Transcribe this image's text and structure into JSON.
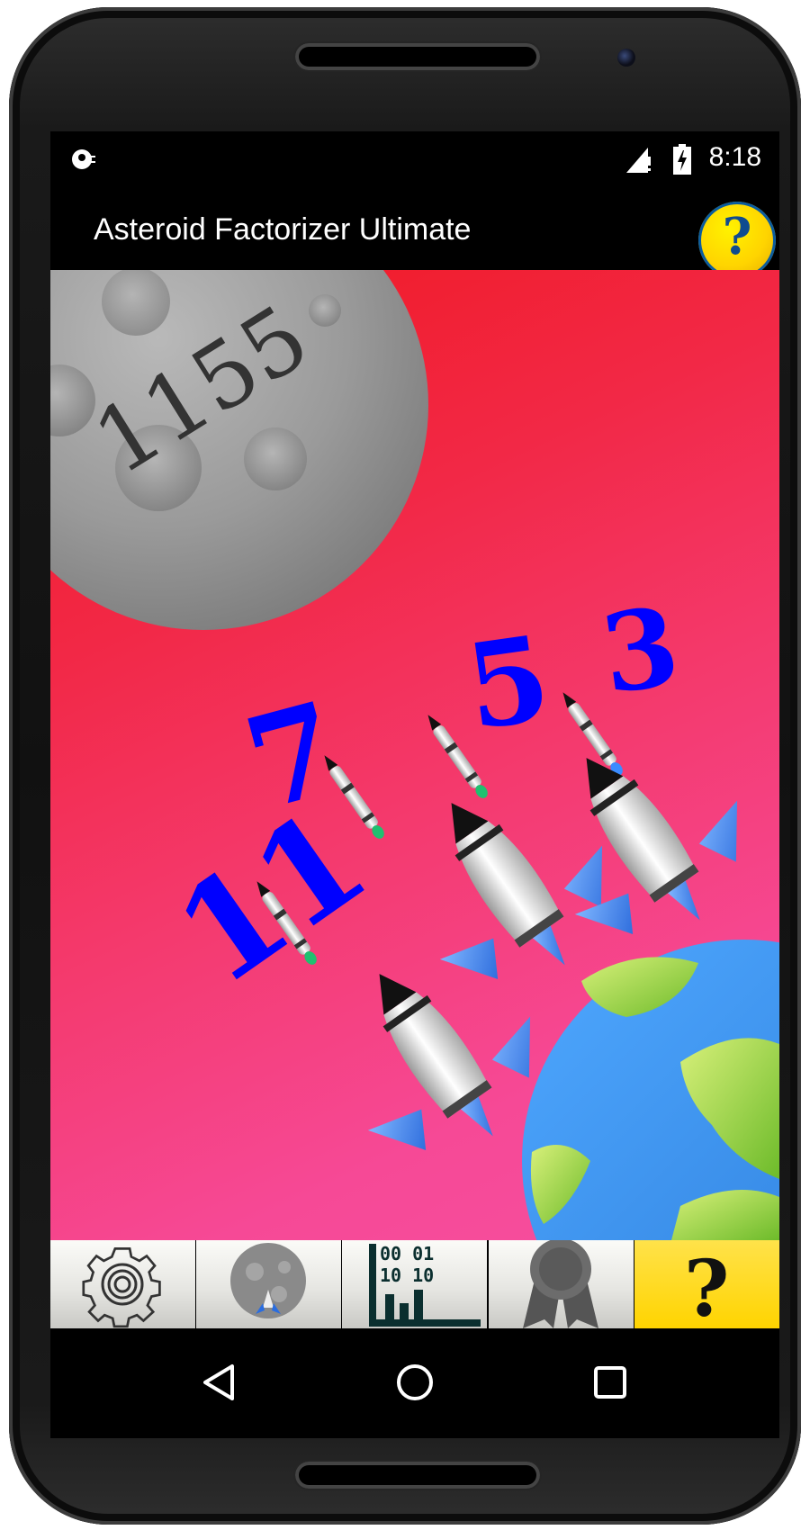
{
  "status_bar": {
    "time": "8:18",
    "left_icon": "notification-app-icon",
    "signal_icon": "signal-icon",
    "battery_icon": "battery-charging-icon"
  },
  "app_bar": {
    "title": "Asteroid Factorizer Ultimate",
    "help_label": "?",
    "help_icon": "help-coin-icon",
    "help_color": "#ffd400"
  },
  "game": {
    "asteroid_number": "1155",
    "factors": [
      "11",
      "7",
      "5",
      "3"
    ],
    "factor_color": "#0000ff",
    "background_colors": [
      "#f01820",
      "#f54fa0"
    ]
  },
  "toolbar": {
    "items": [
      {
        "icon": "gear-icon"
      },
      {
        "icon": "asteroid-game-icon"
      },
      {
        "icon": "binary-chart-icon",
        "text_line1": "00 01",
        "text_line2": "10 10"
      },
      {
        "icon": "award-ribbon-icon"
      },
      {
        "icon": "help-icon",
        "label": "?"
      }
    ]
  },
  "nav_bar": {
    "back_icon": "back-triangle-icon",
    "home_icon": "home-circle-icon",
    "recents_icon": "recents-square-icon"
  }
}
